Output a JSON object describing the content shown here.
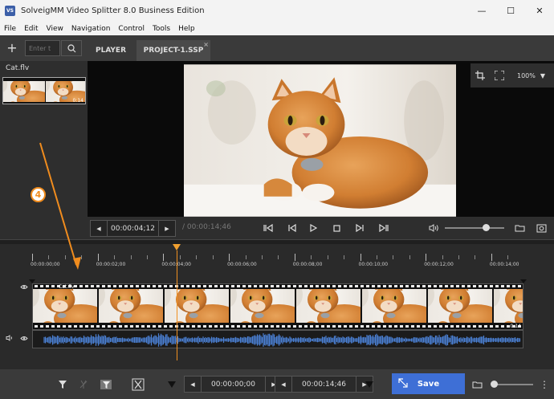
{
  "window": {
    "title": "SolveigMM Video Splitter 8.0 Business Edition",
    "icon_text": "VS",
    "minimize_glyph": "—",
    "maximize_glyph": "☐",
    "close_glyph": "✕"
  },
  "menu": [
    "File",
    "Edit",
    "View",
    "Navigation",
    "Control",
    "Tools",
    "Help"
  ],
  "toolbar": {
    "add_glyph": "+",
    "search_placeholder": "Enter t",
    "tabs": [
      {
        "label": "PLAYER",
        "active": false
      },
      {
        "label": "PROJECT-1.SSP",
        "active": true,
        "close_glyph": "×"
      }
    ]
  },
  "media_list": {
    "items": [
      {
        "name": "Cat.flv",
        "duration": "0:14"
      }
    ]
  },
  "annotation": {
    "badge_number": "4",
    "color": "#f08c1e"
  },
  "player": {
    "zoom": "100%",
    "zoom_arrow": "▼",
    "current_time": "00:00:04;12",
    "total_time": "/ 00:00:14;46",
    "prev_arrow": "◀",
    "next_arrow": "▶",
    "volume_level": 0.7,
    "icons": [
      "crop-icon",
      "fullscreen-icon",
      "prev-keyframe-icon",
      "prev-frame-icon",
      "play-icon",
      "stop-icon",
      "next-frame-icon",
      "next-keyframe-icon",
      "volume-icon",
      "folder-icon",
      "snapshot-icon"
    ]
  },
  "timeline": {
    "ruler_labels": [
      "00:00:00;00",
      "00:00:02;00",
      "00:00:04;00",
      "00:00:06;00",
      "00:00:08;00",
      "00:00:10;00",
      "00:00:12;00",
      "00:00:14;00"
    ],
    "clip_name": "Cat.flv",
    "clip_duration": "0:14",
    "playhead_seconds": 4.4,
    "total_seconds": 14.8,
    "accent_color": "#f09020",
    "audio_color": "#4a7ed0"
  },
  "bottom_bar": {
    "start_time": "00:00:00;00",
    "end_time": "00:00:14;46",
    "prev_arrow": "◀",
    "next_arrow": "▶",
    "save_label": "Save",
    "save_color": "#3e6fd6",
    "speed_level": 0.0,
    "menu_glyph": "⋮"
  }
}
